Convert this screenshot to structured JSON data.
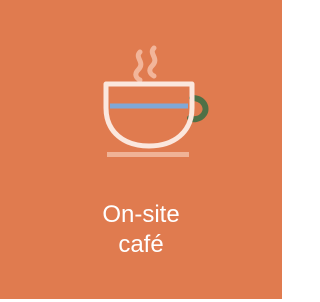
{
  "tile": {
    "label_line1": "On-site",
    "label_line2": "café",
    "icon": "coffee-cup-icon",
    "colors": {
      "background": "#e07b4f",
      "cup_outline": "#fbe7dd",
      "steam": "#f2b59a",
      "coffee_line": "#7fa8d8",
      "handle": "#4f7046",
      "saucer": "#f0b295",
      "text": "#ffffff"
    }
  }
}
